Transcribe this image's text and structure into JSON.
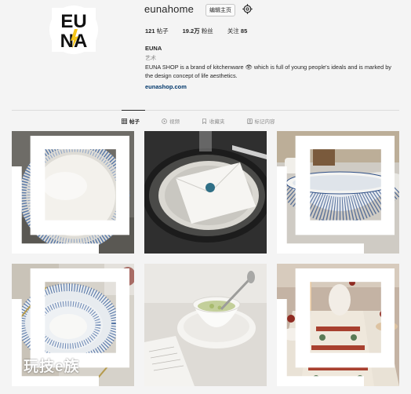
{
  "profile": {
    "username": "eunahome",
    "edit_label": "编辑主页",
    "logo_text": "EUNA",
    "stats": {
      "posts_count": "121",
      "posts_label": "帖子",
      "followers_count": "19.2万",
      "followers_label": "粉丝",
      "following_label": "关注",
      "following_count": "85"
    },
    "name": "EUNA",
    "category": "艺术",
    "bio": "EUNA SHOP is a brand of kitchenware 👁 which is full of young people's ideals and is marked by the design concept of life aesthetics.",
    "website": "eunashop.com"
  },
  "tabs": [
    {
      "label": "帖子",
      "icon": "grid-icon",
      "active": true
    },
    {
      "label": "视频",
      "icon": "video-icon",
      "active": false
    },
    {
      "label": "收藏夹",
      "icon": "bookmark-icon",
      "active": false
    },
    {
      "label": "标记内容",
      "icon": "tag-icon",
      "active": false
    }
  ],
  "posts": [
    {
      "subject": "blue-rim-plate",
      "multi": true
    },
    {
      "subject": "envelope-on-plates",
      "multi": false
    },
    {
      "subject": "striped-bowl",
      "multi": true
    },
    {
      "subject": "striped-plates-setting",
      "multi": true
    },
    {
      "subject": "teacup-with-spoon",
      "multi": false
    },
    {
      "subject": "table-runner-setting",
      "multi": true
    }
  ],
  "watermark": "玩技e族",
  "colors": {
    "text": "#262626",
    "muted": "#8e8e8e",
    "link": "#00376b",
    "logo_yellow": "#f5c518",
    "divider": "#dbdbdb"
  }
}
